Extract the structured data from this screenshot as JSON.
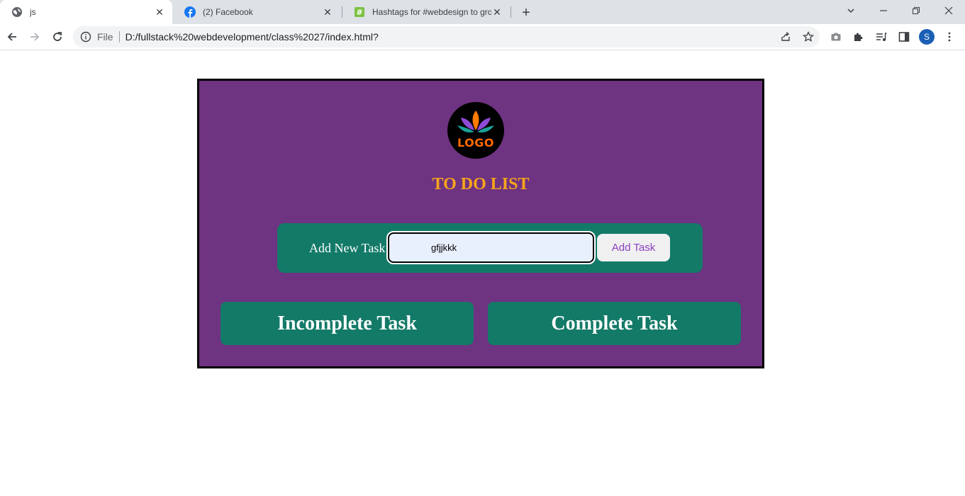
{
  "browser": {
    "tabs": [
      {
        "title": "js",
        "icon": "globe-icon"
      },
      {
        "title": "(2) Facebook",
        "icon": "facebook-icon"
      },
      {
        "title": "Hashtags for #webdesign to grow",
        "icon": "hashtag-icon"
      }
    ],
    "omnibox": {
      "scheme_label": "File",
      "url": "D:/fullstack%20webdevelopment/class%2027/index.html?"
    },
    "profile_initial": "S"
  },
  "page": {
    "logo_text": "LOGO",
    "heading": "TO DO LIST",
    "add_task_label": "Add New Task",
    "task_input_value": "gfjjkkk",
    "add_button_label": "Add Task",
    "incomplete_heading": "Incomplete Task",
    "complete_heading": "Complete Task"
  },
  "colors": {
    "app_background": "#6e3381",
    "panel_teal": "#137a68",
    "heading_orange": "#f7a51b",
    "button_text_purple": "#8a3fbf"
  }
}
